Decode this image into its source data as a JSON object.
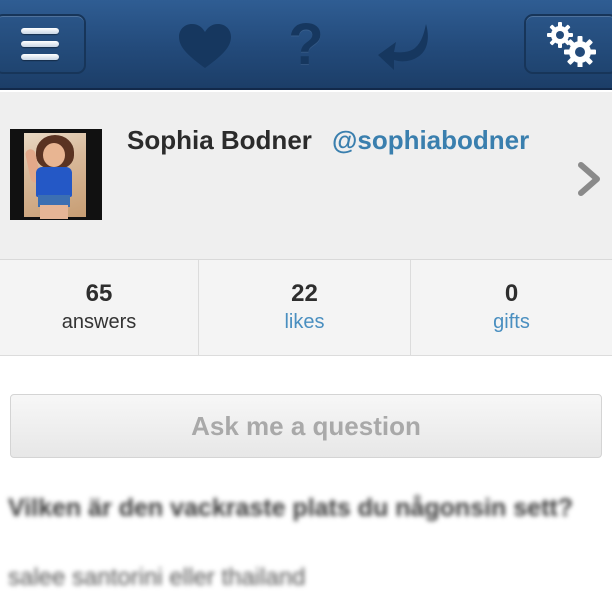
{
  "nav": {
    "icons": [
      "menu-icon",
      "heart-icon",
      "help-icon",
      "reply-icon",
      "gears-icon"
    ],
    "help_glyph": "?",
    "colors": {
      "bar": "#234a7a",
      "icon_dark": "#16375f",
      "icon_light": "#ffffff"
    }
  },
  "profile": {
    "name": "Sophia Bodner",
    "handle": "@sophiabodner",
    "handle_color": "#3a7fae"
  },
  "stats": [
    {
      "count": "65",
      "label": "answers"
    },
    {
      "count": "22",
      "label": "likes"
    },
    {
      "count": "0",
      "label": "gifts"
    }
  ],
  "ask": {
    "button_label": "Ask me a question"
  },
  "feed": {
    "question": "Vilken är den vackraste plats du någonsin sett?",
    "answer": "salee santorini eller thailand"
  }
}
